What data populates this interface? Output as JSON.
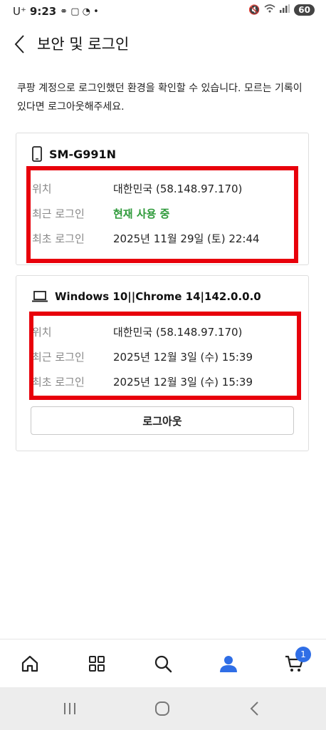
{
  "status_bar": {
    "carrier": "U⁺",
    "time": "9:23",
    "battery": "60"
  },
  "header": {
    "title": "보안 및 로그인"
  },
  "description": "쿠팡 계정으로 로그인했던 환경을 확인할 수 있습니다. 모르는 기록이 있다면 로그아웃해주세요.",
  "sessions": [
    {
      "device_icon": "smartphone-icon",
      "device": "SM-G991N",
      "rows": [
        {
          "label": "위치",
          "value": "대한민국 (58.148.97.170)"
        },
        {
          "label": "최근 로그인",
          "value": "현재 사용 중"
        },
        {
          "label": "최초 로그인",
          "value": "2025년 11월 29일 (토) 22:44"
        }
      ]
    },
    {
      "device_icon": "laptop-icon",
      "device": "Windows 10||Chrome 14|142.0.0.0",
      "rows": [
        {
          "label": "위치",
          "value": "대한민국 (58.148.97.170)"
        },
        {
          "label": "최근 로그인",
          "value": "2025년 12월 3일 (수) 15:39"
        },
        {
          "label": "최초 로그인",
          "value": "2025년 12월 3일 (수) 15:39"
        }
      ],
      "logout_label": "로그아웃"
    }
  ],
  "bottom_nav": {
    "items": [
      "home-icon",
      "category-icon",
      "search-icon",
      "my-coupang-icon",
      "cart-icon"
    ],
    "cart_badge": "1"
  },
  "colors": {
    "active_status": "#2e9a3a",
    "highlight": "#e8000b",
    "accent": "#2f6ee6"
  }
}
